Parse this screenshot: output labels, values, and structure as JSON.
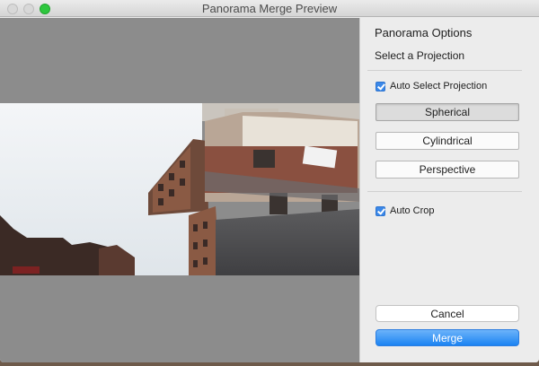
{
  "window": {
    "title": "Panorama Merge Preview"
  },
  "panel": {
    "heading": "Panorama Options",
    "subheading": "Select a Projection",
    "auto_select": {
      "label": "Auto Select Projection",
      "checked": true
    },
    "projections": [
      {
        "label": "Spherical",
        "selected": true
      },
      {
        "label": "Cylindrical",
        "selected": false
      },
      {
        "label": "Perspective",
        "selected": false
      }
    ],
    "auto_crop": {
      "label": "Auto Crop",
      "checked": true
    },
    "cancel_label": "Cancel",
    "merge_label": "Merge"
  },
  "colors": {
    "accent": "#1b83f2",
    "zoom_button": "#2ec73e"
  }
}
